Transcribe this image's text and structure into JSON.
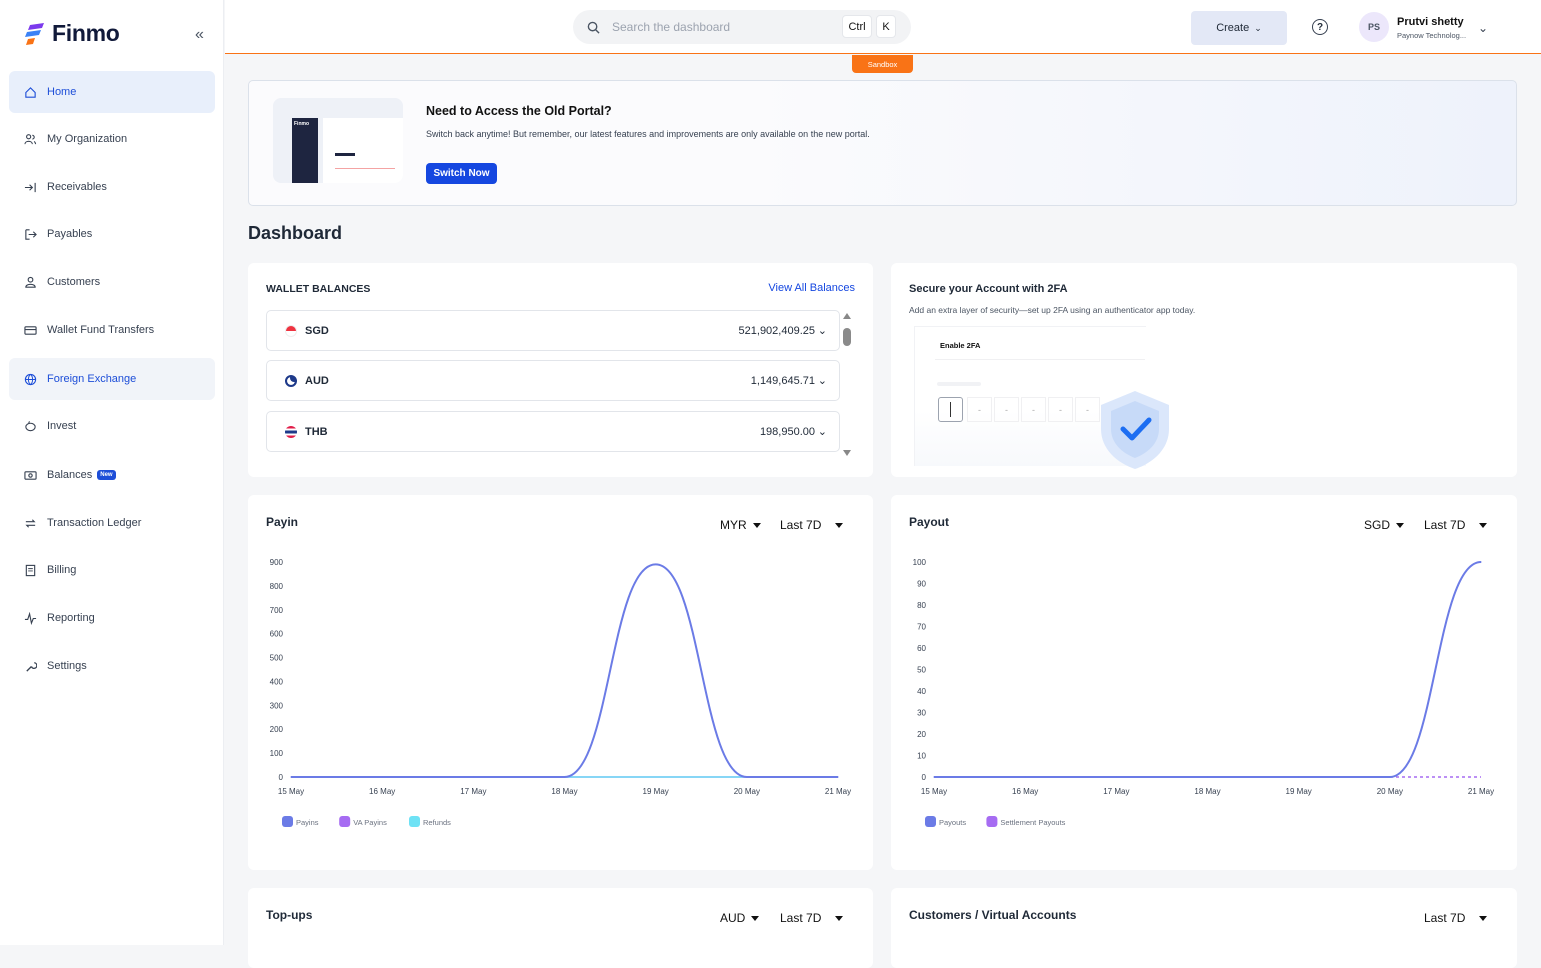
{
  "app": {
    "name": "Finmo"
  },
  "sidebar": {
    "items": [
      {
        "label": "Home",
        "icon": "home-icon"
      },
      {
        "label": "My Organization",
        "icon": "users-icon"
      },
      {
        "label": "Receivables",
        "icon": "arrow-in-icon"
      },
      {
        "label": "Payables",
        "icon": "arrow-out-icon"
      },
      {
        "label": "Customers",
        "icon": "user-icon"
      },
      {
        "label": "Wallet Fund Transfers",
        "icon": "card-icon"
      },
      {
        "label": "Foreign Exchange",
        "icon": "globe-icon"
      },
      {
        "label": "Invest",
        "icon": "piggy-icon"
      },
      {
        "label": "Balances",
        "icon": "cash-icon",
        "badge": "New"
      },
      {
        "label": "Transaction Ledger",
        "icon": "repeat-icon"
      },
      {
        "label": "Billing",
        "icon": "receipt-icon"
      },
      {
        "label": "Reporting",
        "icon": "pulse-icon"
      },
      {
        "label": "Settings",
        "icon": "wrench-icon"
      }
    ]
  },
  "header": {
    "search_placeholder": "Search the dashboard",
    "shortcut_ctrl": "Ctrl",
    "shortcut_key": "K",
    "create_label": "Create",
    "user_initials": "PS",
    "user_name": "Prutvi shetty",
    "user_org": "Paynow Technolog...",
    "environment": "Sandbox"
  },
  "banner": {
    "title": "Need to Access the Old Portal?",
    "text": "Switch back anytime! But remember, our latest features and improvements are only available on the new portal.",
    "button": "Switch Now",
    "thumb_logo": "Finmo"
  },
  "page": {
    "title": "Dashboard"
  },
  "wallet": {
    "title": "WALLET BALANCES",
    "link": "View All Balances",
    "rows": [
      {
        "code": "SGD",
        "amount": "521,902,409.25"
      },
      {
        "code": "AUD",
        "amount": "1,149,645.71"
      },
      {
        "code": "THB",
        "amount": "198,950.00"
      }
    ]
  },
  "twofa": {
    "title": "Secure your Account with 2FA",
    "text": "Add an extra layer of security—set up 2FA using an authenticator app today.",
    "card_label": "Enable 2FA"
  },
  "payin": {
    "title": "Payin",
    "currency": "MYR",
    "range": "Last 7D"
  },
  "payout": {
    "title": "Payout",
    "currency": "SGD",
    "range": "Last 7D"
  },
  "topups": {
    "title": "Top-ups",
    "currency": "AUD",
    "range": "Last 7D"
  },
  "customers": {
    "title": "Customers / Virtual Accounts",
    "range": "Last 7D"
  },
  "colors": {
    "accent": "#1547e0",
    "sandbox": "#f97316",
    "line": "#6b7be6",
    "va": "#a66cf2",
    "refunds": "#6ee2f5"
  },
  "chart_data": [
    {
      "type": "line",
      "title": "Payin",
      "x": [
        "15 May",
        "16 May",
        "17 May",
        "18 May",
        "19 May",
        "20 May",
        "21 May"
      ],
      "ylim": [
        0,
        900
      ],
      "yticks": [
        0,
        100,
        200,
        300,
        400,
        500,
        600,
        700,
        800,
        900
      ],
      "series": [
        {
          "name": "Payins",
          "values": [
            0,
            0,
            0,
            0,
            890,
            0,
            0
          ],
          "color": "#6b7be6"
        },
        {
          "name": "VA Payins",
          "values": [
            0,
            0,
            0,
            0,
            0,
            0,
            0
          ],
          "color": "#a66cf2"
        },
        {
          "name": "Refunds",
          "values": [
            0,
            0,
            0,
            0,
            0,
            0,
            0
          ],
          "color": "#6ee2f5"
        }
      ]
    },
    {
      "type": "line",
      "title": "Payout",
      "x": [
        "15 May",
        "16 May",
        "17 May",
        "18 May",
        "19 May",
        "20 May",
        "21 May"
      ],
      "ylim": [
        0,
        100
      ],
      "yticks": [
        0,
        10,
        20,
        30,
        40,
        50,
        60,
        70,
        80,
        90,
        100
      ],
      "series": [
        {
          "name": "Payouts",
          "values": [
            0,
            0,
            0,
            0,
            0,
            0,
            100
          ],
          "color": "#6b7be6"
        },
        {
          "name": "Settlement Payouts",
          "values": [
            0,
            0,
            0,
            0,
            0,
            0,
            0
          ],
          "color": "#a66cf2"
        }
      ]
    }
  ]
}
